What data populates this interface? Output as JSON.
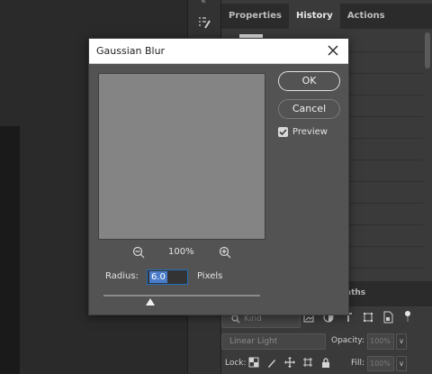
{
  "panel": {
    "tabs": [
      {
        "label": "Properties",
        "active": false
      },
      {
        "label": "History",
        "active": true
      },
      {
        "label": "Actions",
        "active": false
      }
    ],
    "paths_tab": "aths"
  },
  "dialog": {
    "title": "Gaussian Blur",
    "ok_label": "OK",
    "cancel_label": "Cancel",
    "preview_label": "Preview",
    "preview_checked": true,
    "zoom_value": "100%",
    "radius_label": "Radius:",
    "radius_value": "6.0",
    "radius_unit": "Pixels",
    "radius_slider_fraction": 0.3
  },
  "layers": {
    "kind_placeholder": "Kind",
    "blend_mode": "Linear Light",
    "opacity_label": "Opacity:",
    "opacity_value": "100%",
    "lock_label": "Lock:",
    "fill_label": "Fill:",
    "fill_value": "100%"
  },
  "colors": {
    "dialog_bg": "#535353",
    "accent_selection": "#4a7cc9",
    "panel_bg": "#3a3a3a"
  }
}
